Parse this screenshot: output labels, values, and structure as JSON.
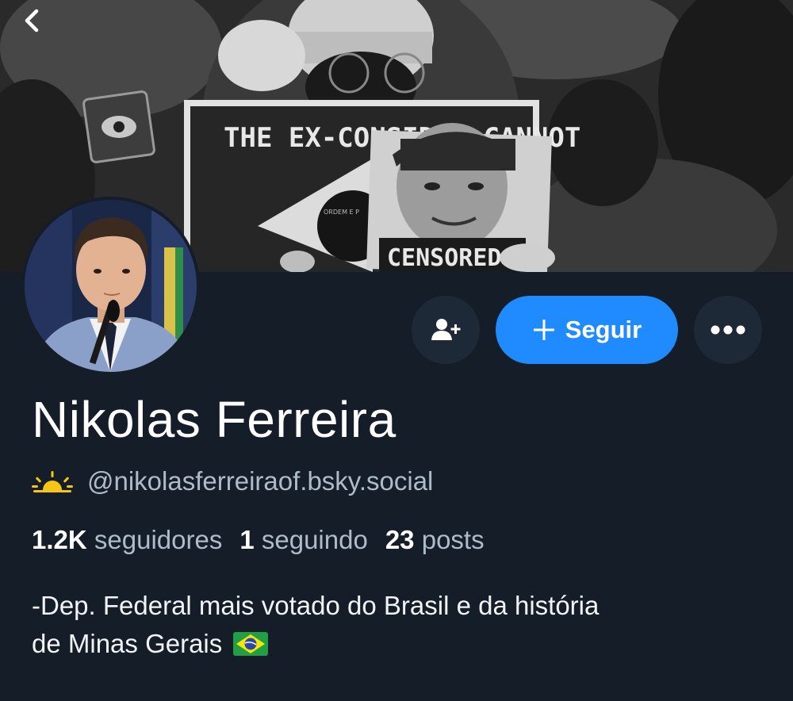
{
  "banner": {
    "sign_text": "THE EX-CONSIDER CANNOT",
    "censored_text": "CENSORED",
    "flag_motto": "ORDEM E P"
  },
  "actions": {
    "follow_label": "Seguir"
  },
  "profile": {
    "display_name": "Nikolas Ferreira",
    "handle": "@nikolasferreiraof.bsky.social",
    "stats": {
      "followers_count": "1.2K",
      "followers_label": "seguidores",
      "following_count": "1",
      "following_label": "seguindo",
      "posts_count": "23",
      "posts_label": "posts"
    },
    "bio": {
      "line1": "-Dep. Federal mais votado do Brasil e da história",
      "line2": "de Minas Gerais"
    }
  },
  "colors": {
    "background": "#151d28",
    "button_dark": "#1e2937",
    "accent": "#208bfe",
    "muted_text": "#aebbc9",
    "sun_icon": "#f5c518"
  },
  "icons": [
    "back-chevron-icon",
    "add-user-icon",
    "plus-icon",
    "more-dots-icon",
    "sunrise-icon",
    "brazil-flag-icon"
  ]
}
